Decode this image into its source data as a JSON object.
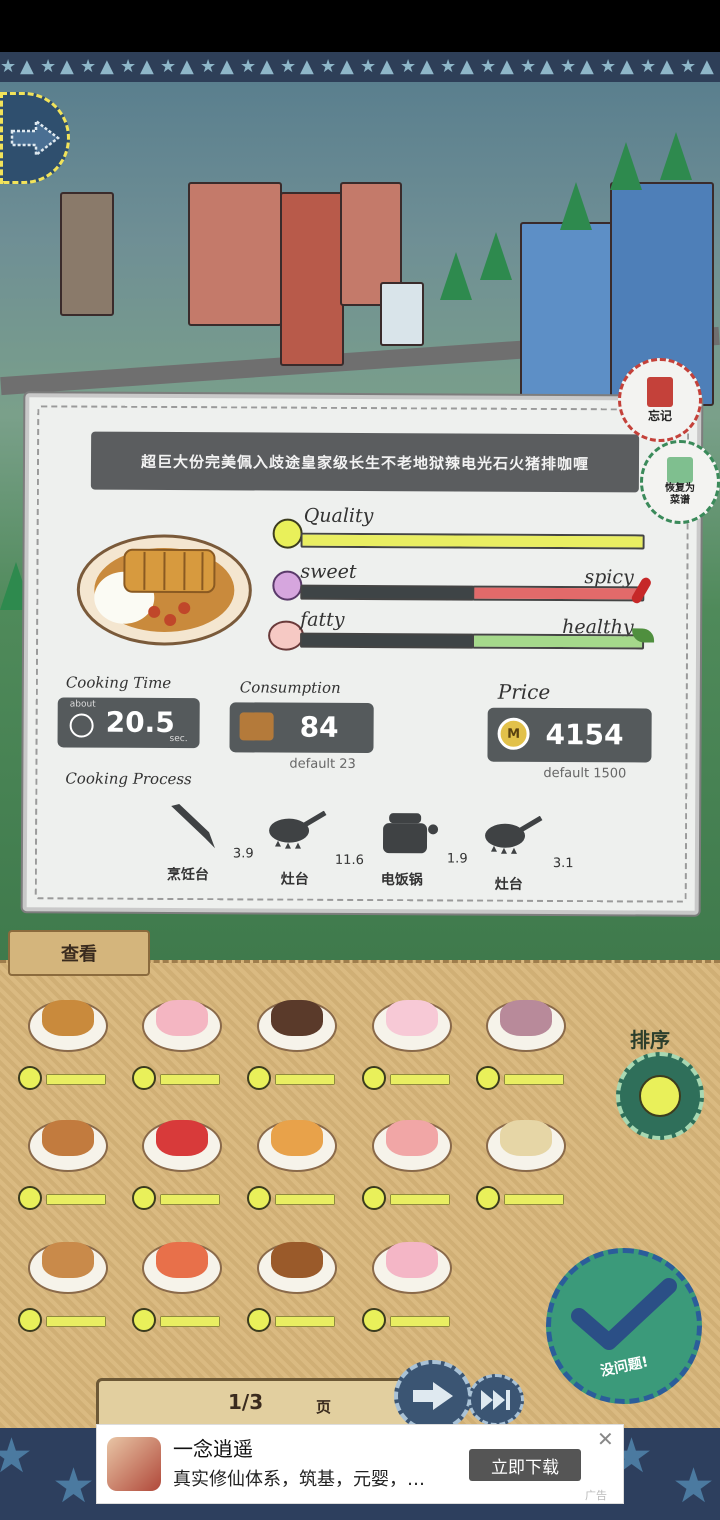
{
  "recipe": {
    "title": "超巨大份完美佩入歧途皇家级长生不老地狱辣电光石火猪排咖喱",
    "meters": {
      "quality_label": "Quality",
      "quality_level": 1.0,
      "sweet_label": "sweet",
      "spicy_label": "spicy",
      "spicy_level": 1.0,
      "fatty_label": "fatty",
      "healthy_label": "healthy",
      "healthy_level": 1.0
    },
    "cooking_time": {
      "label": "Cooking Time",
      "prefix": "about",
      "value": "20.5",
      "unit": "sec."
    },
    "consumption": {
      "label": "Consumption",
      "value": "84",
      "default": "default 23"
    },
    "price": {
      "label": "Price",
      "value": "4154",
      "default": "default 1500",
      "coin_symbol": "M"
    },
    "process_label": "Cooking Process",
    "process": [
      {
        "name": "烹饪台",
        "time": "3.9",
        "icon": "knife-icon"
      },
      {
        "name": "灶台",
        "time": "11.6",
        "icon": "pan-icon"
      },
      {
        "name": "电饭锅",
        "time": "1.9",
        "icon": "rice-cooker-icon"
      },
      {
        "name": "灶台",
        "time": "3.1",
        "icon": "pan-icon"
      }
    ]
  },
  "side_buttons": {
    "forget_label": "忘记",
    "restore_label": "恢复为\n菜谱"
  },
  "panel": {
    "tab_label": "查看",
    "sort_label": "排序",
    "confirm_label": "没问题!",
    "page": "1/3",
    "page_unit": "页",
    "dishes": [
      {
        "name": "katsu-curry",
        "quality": 1.0
      },
      {
        "name": "strawberry-parfait",
        "quality": 1.0
      },
      {
        "name": "meat-rolls",
        "quality": 1.0
      },
      {
        "name": "bunny-parfait",
        "quality": 1.0
      },
      {
        "name": "rice-bowl",
        "quality": 1.0
      },
      {
        "name": "tempura-bowl",
        "quality": 1.0
      },
      {
        "name": "bento-car",
        "quality": 1.0
      },
      {
        "name": "pie",
        "quality": 1.0
      },
      {
        "name": "fruit-parfait",
        "quality": 1.0
      },
      {
        "name": "mont-blanc",
        "quality": 1.0
      },
      {
        "name": "onion-rings",
        "quality": 1.0
      },
      {
        "name": "shrimp-plate",
        "quality": 1.0
      },
      {
        "name": "burger",
        "quality": 1.0
      },
      {
        "name": "pink-bunny-parfait",
        "quality": 1.0
      }
    ]
  },
  "ad": {
    "title": "一念逍遥",
    "desc": "真实修仙体系，筑基，元婴，…",
    "button": "立即下载",
    "close": "✕",
    "tag": "广告"
  }
}
